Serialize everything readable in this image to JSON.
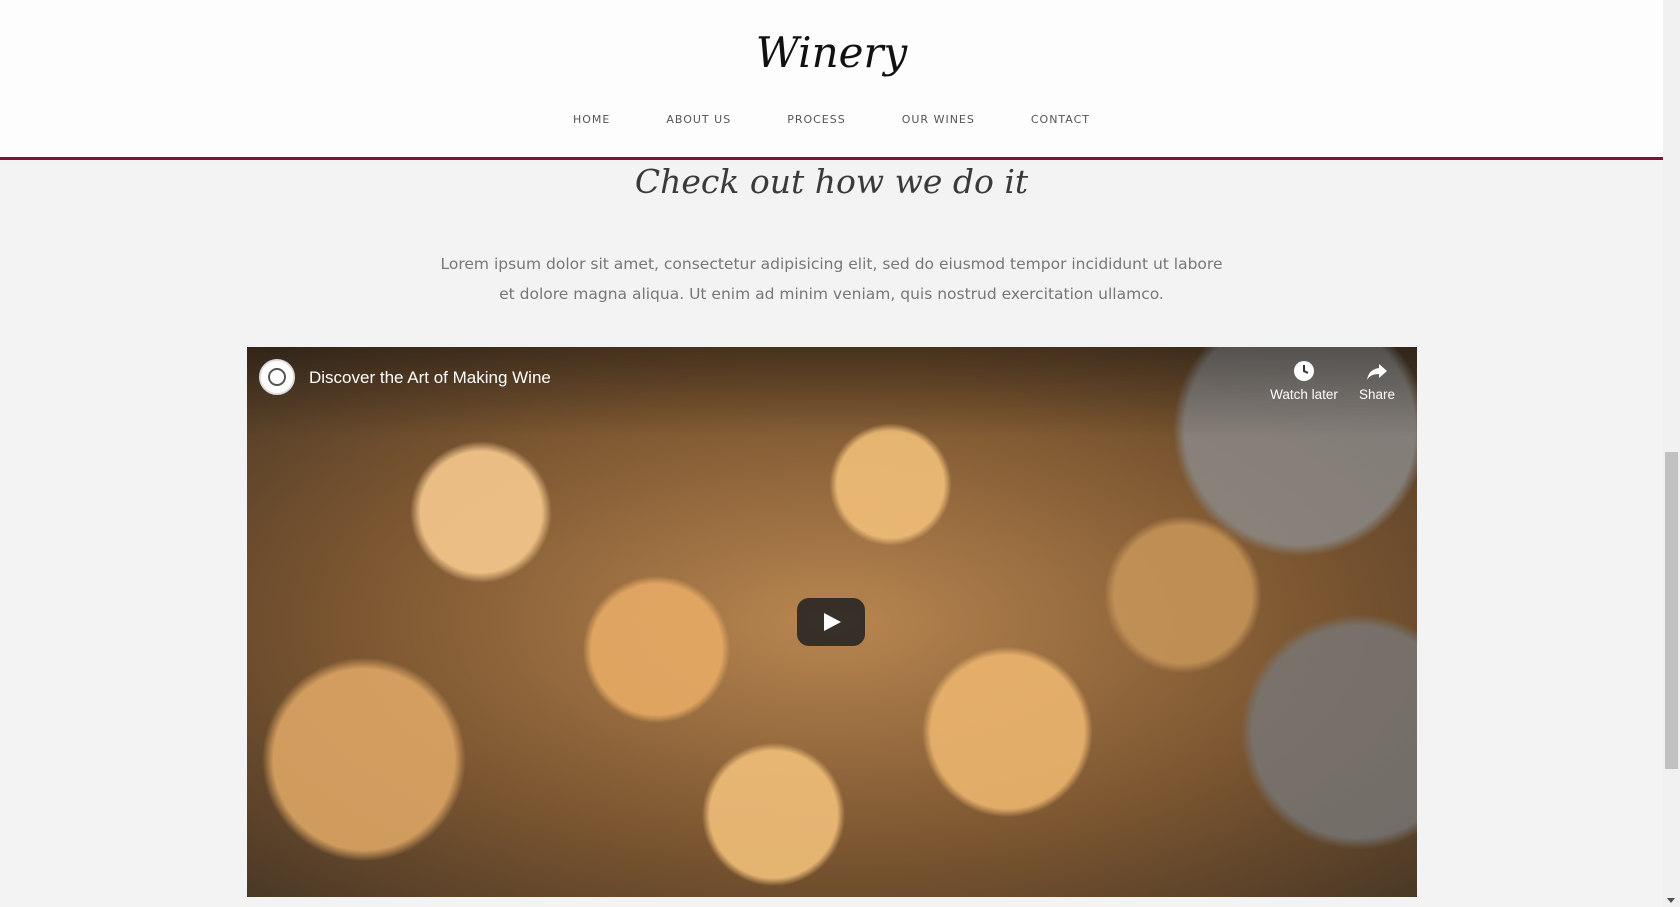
{
  "header": {
    "logo": "Winery",
    "nav": [
      "HOME",
      "ABOUT US",
      "PROCESS",
      "OUR WINES",
      "CONTACT"
    ],
    "accent_color": "#7a1432"
  },
  "section": {
    "title": "Check out how we do it",
    "text": "Lorem ipsum dolor sit amet, consectetur adipisicing elit, sed do eiusmod tempor incididunt ut labore et dolore magna aliqua. Ut enim ad minim veniam, quis nostrud exercitation ullamco."
  },
  "video": {
    "title": "Discover the Art of Making Wine",
    "watch_later_label": "Watch later",
    "share_label": "Share",
    "icons": {
      "watch_later": "clock-icon",
      "share": "share-arrow-icon",
      "play": "play-icon"
    }
  }
}
